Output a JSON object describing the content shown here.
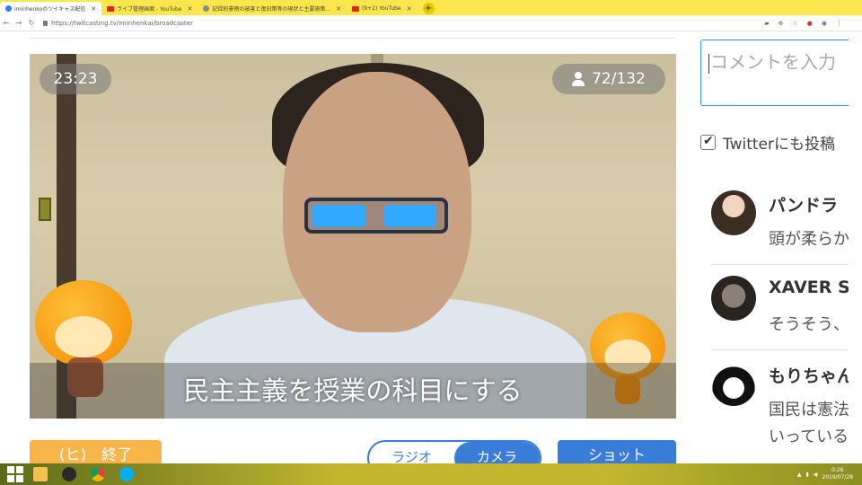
{
  "browser": {
    "tabs": [
      {
        "title": "iminhenkoのツイキャス配信",
        "active": true,
        "favicon": "twitcasting"
      },
      {
        "title": "ライブ管理画面 - YouTube",
        "active": false,
        "favicon": "youtube"
      },
      {
        "title": "記録的豪雨の被害と復旧策等の現状と主要施策...",
        "active": false,
        "favicon": "web"
      },
      {
        "title": "(9+2) YouTube",
        "active": false,
        "favicon": "youtube"
      }
    ],
    "new_tab_label": "+",
    "url": "https://twitcasting.tv/iminhenkai/broadcaster"
  },
  "broadcast": {
    "elapsed_time": "23:23",
    "viewers": "72/132",
    "subtitle": "民主主義を授業の科目にする"
  },
  "controls": {
    "end_button": "(ヒ)　終了",
    "radio_label": "ラジオ",
    "camera_label": "カメラ",
    "shot_button": "ショット"
  },
  "comments_panel": {
    "input_placeholder": "コメントを入力",
    "twitter_checkbox_label": "Twitterにも投稿",
    "twitter_checked": true,
    "comments": [
      {
        "name": "パンドラ",
        "text": "頭が柔らか"
      },
      {
        "name": "XAVER S",
        "text": "そうそう、"
      },
      {
        "name": "もりちゃん",
        "text": "国民は憲法\nいっている"
      }
    ]
  },
  "taskbar": {
    "time": "0:26",
    "date": "2019/07/28"
  },
  "colors": {
    "accent_blue": "#3a7dd8",
    "end_orange": "#f7b54a",
    "tabstrip_yellow": "#fbe74d"
  }
}
